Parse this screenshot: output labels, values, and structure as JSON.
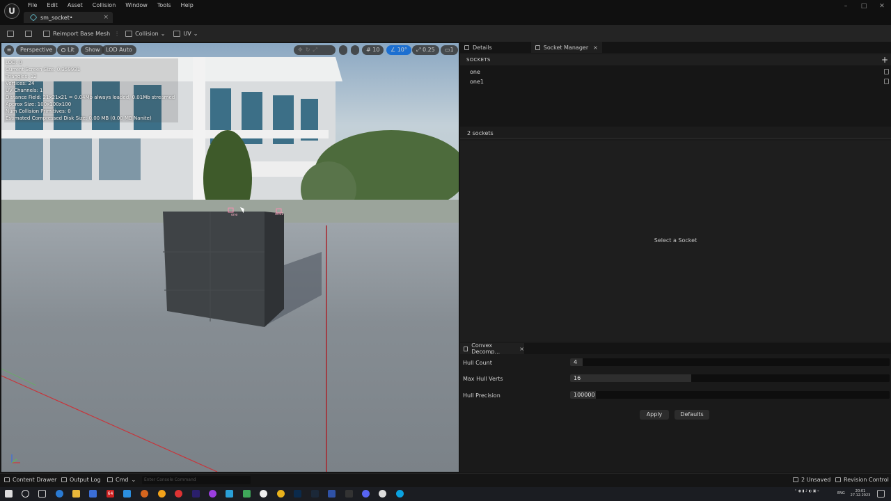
{
  "menu": [
    "File",
    "Edit",
    "Asset",
    "Collision",
    "Window",
    "Tools",
    "Help"
  ],
  "tab": {
    "label": "sm_socket•",
    "close": "×"
  },
  "window_controls": [
    "–",
    "□",
    "✕"
  ],
  "toolbar": {
    "reimport_label": "Reimport Base Mesh",
    "collision_label": "Collision",
    "uv_label": "UV"
  },
  "viewport": {
    "perspective": "Perspective",
    "lit": "Lit",
    "show": "Show",
    "lod": "LOD Auto",
    "grid_snap": "10",
    "rot_snap": "10°",
    "scale_snap": "0.25",
    "camera_speed": "1",
    "stats": [
      "LOD:  0",
      "Current Screen Size:  0.359931",
      "Triangles:  12",
      "Vertices:  24",
      "UV Channels:  1",
      "Distance Field:  21x21x21 = 0.04Mb always loaded, 0.01Mb streamed",
      "Approx Size: 100x100x100",
      "Num Collision Primitives:  0",
      "Estimated Compressed Disk Size: 0.00 MB (0.00 MB Nanite)"
    ],
    "socket_labels": [
      "one",
      "one1"
    ]
  },
  "panels": {
    "details_tab": "Details",
    "socket_manager_tab": "Socket Manager",
    "sockets_header": "SOCKETS",
    "sockets": [
      "one",
      "one1"
    ],
    "socket_count": "2 sockets",
    "select_hint": "Select a Socket"
  },
  "convex": {
    "tab": "Convex Decomp...",
    "rows": [
      {
        "label": "Hull Count",
        "value": "4",
        "fill": 0.04
      },
      {
        "label": "Max Hull Verts",
        "value": "16",
        "fill": 0.38
      },
      {
        "label": "Hull Precision",
        "value": "100000",
        "fill": 0.08
      }
    ],
    "apply": "Apply",
    "defaults": "Defaults"
  },
  "statusbar": {
    "content_drawer": "Content Drawer",
    "output_log": "Output Log",
    "cmd": "Cmd",
    "console_placeholder": "Enter Console Command",
    "unsaved": "2 Unsaved",
    "revision": "Revision Control"
  },
  "taskbar": {
    "lang": "ENG",
    "time": "20:01",
    "date": "27.12.2023"
  },
  "colors": {
    "accent": "#5aa9b5",
    "viewport_floor": "#868d93",
    "axis_red": "#c8343a",
    "axis_green": "#6aa86a"
  }
}
